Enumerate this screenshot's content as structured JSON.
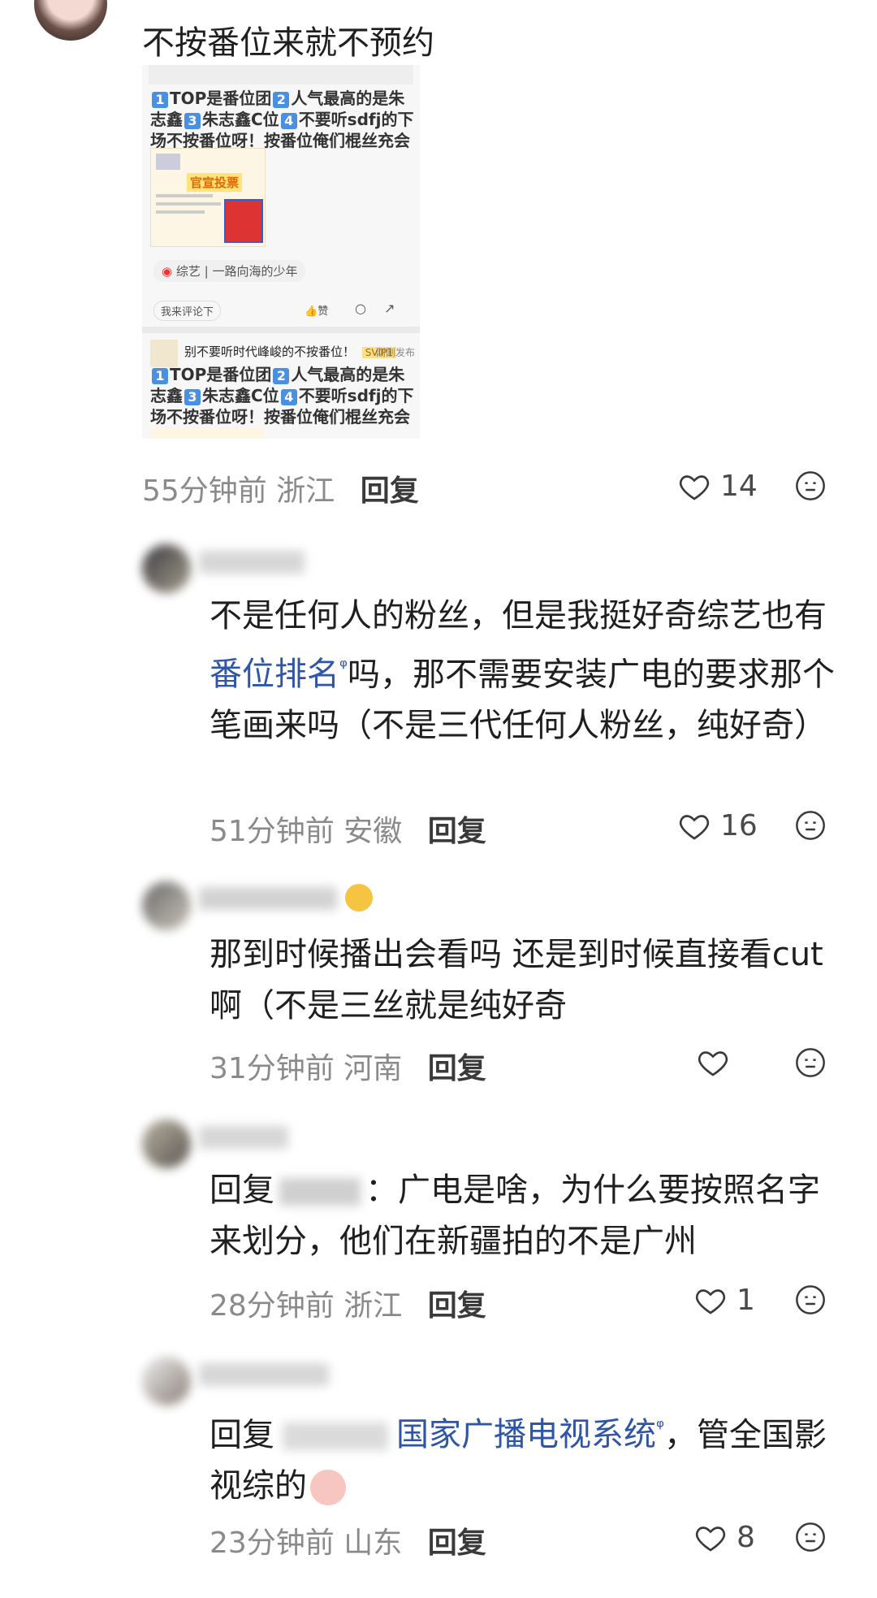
{
  "top_comment": {
    "text": "不按番位来就不预约",
    "time": "55分钟前",
    "location": "浙江",
    "reply_label": "回复",
    "likes": "14"
  },
  "embed": {
    "post_text_1": "TOP是番位团",
    "post_text_2": "人气最高的是朱志鑫",
    "post_text_3": "朱志鑫C位",
    "post_text_4": "不要听sdfj的下场不按番位呀！按番位俺们棍丝充会员哦！",
    "poster_highlight": "官宣投票",
    "tag": "综艺 | 一路向海的少年",
    "comment_placeholder": "我来评论下",
    "like_label": "赞",
    "header_2": "别不要听时代峰峻的不按番位！",
    "badge": "SVIP1",
    "time_2": "刚刚发布",
    "post2_text_1": "TOP是番位团",
    "post2_text_2": "人气最高的是朱志鑫",
    "post2_text_3": "朱志鑫C位",
    "post2_text_4": "不要听sdfj的下场不按番位呀！按番位俺们棍丝充会员哦！",
    "n1": "1",
    "n2": "2",
    "n3": "3",
    "n4": "4"
  },
  "comments": [
    {
      "text_a": "不是任何人的粉丝，但是我挺好奇综艺也有",
      "link": "番位排名",
      "text_b": "吗，那不需要安装广电的要求那个笔画来吗（不是三代任何人粉丝，纯好奇）",
      "time": "51分钟前",
      "location": "安徽",
      "reply_label": "回复",
      "likes": "16"
    },
    {
      "text_a": "那到时候播出会看吗 还是到时候直接看cut啊（不是三丝就是纯好奇",
      "time": "31分钟前",
      "location": "河南",
      "reply_label": "回复",
      "likes": ""
    },
    {
      "prefix": "回复",
      "text_a": "：广电是啥，为什么要按照名字来划分，他们在新疆拍的不是广州",
      "time": "28分钟前",
      "location": "浙江",
      "reply_label": "回复",
      "likes": "1"
    },
    {
      "prefix": "回复",
      "link": "国家广播电视系统",
      "text_b": "，管全国影视综的",
      "time": "23分钟前",
      "location": "山东",
      "reply_label": "回复",
      "likes": "8"
    }
  ],
  "colors": {
    "link": "#2e55a6",
    "meta": "#8a8a8a"
  },
  "icons": [
    "heart-icon",
    "emoji-face-icon",
    "search-link-icon"
  ]
}
